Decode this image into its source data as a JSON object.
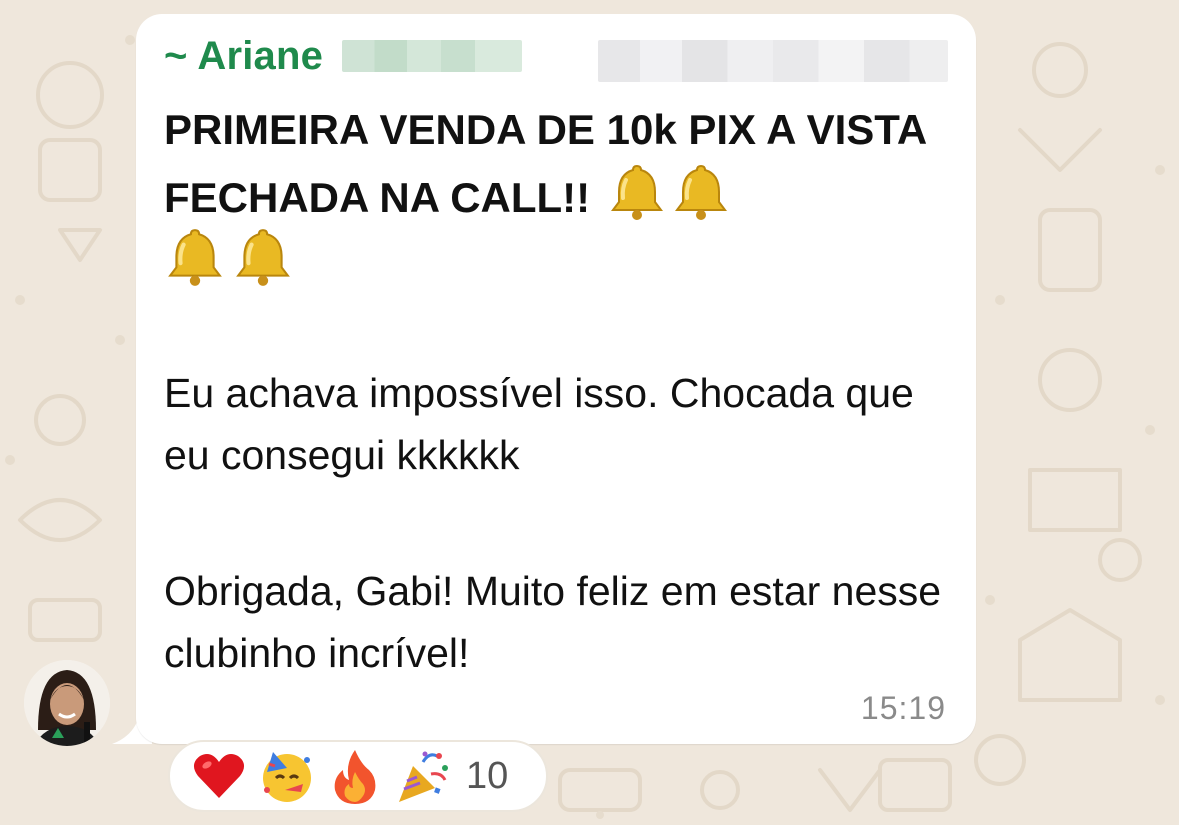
{
  "message": {
    "sender": "~ Ariane",
    "headline": "PRIMEIRA VENDA DE 10k PIX A VISTA FECHADA NA CALL!!",
    "paragraph1": "Eu achava impossível isso. Chocada que eu consegui kkkkkk",
    "paragraph2": "Obrigada, Gabi! Muito feliz em estar nesse clubinho incrível!",
    "time": "15:19",
    "bell_emoji": "bell-icon",
    "bell_count": 4
  },
  "reactions": {
    "icons": [
      "heart-icon",
      "partying-face-icon",
      "fire-icon",
      "party-popper-icon"
    ],
    "count": "10"
  },
  "colors": {
    "wallpaper": "#efe7dc",
    "sender_name": "#1f8a4c",
    "bubble": "#ffffff",
    "timestamp": "#8a8a8a"
  }
}
